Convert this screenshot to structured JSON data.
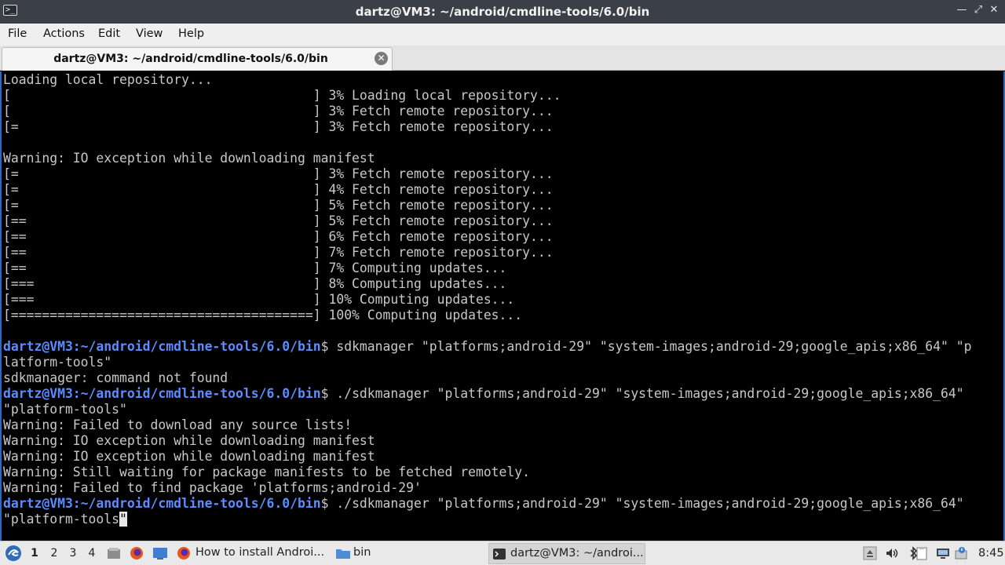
{
  "window": {
    "title": "dartz@VM3: ~/android/cmdline-tools/6.0/bin",
    "controls": [
      "—",
      "⤢",
      "✕"
    ]
  },
  "menu": [
    "File",
    "Actions",
    "Edit",
    "View",
    "Help"
  ],
  "tab": {
    "label": "dartz@VM3: ~/android/cmdline-tools/6.0/bin",
    "close": "✕"
  },
  "terminal": {
    "prompt": "dartz@VM3:~/android/cmdline-tools/6.0/bin",
    "lines": [
      {
        "text": "Loading local repository..."
      },
      {
        "text": "[                                       ] 3% Loading local repository..."
      },
      {
        "text": "[                                       ] 3% Fetch remote repository..."
      },
      {
        "text": "[=                                      ] 3% Fetch remote repository..."
      },
      {
        "text": ""
      },
      {
        "text": "Warning: IO exception while downloading manifest"
      },
      {
        "text": "[=                                      ] 3% Fetch remote repository..."
      },
      {
        "text": "[=                                      ] 4% Fetch remote repository..."
      },
      {
        "text": "[=                                      ] 5% Fetch remote repository..."
      },
      {
        "text": "[==                                     ] 5% Fetch remote repository..."
      },
      {
        "text": "[==                                     ] 6% Fetch remote repository..."
      },
      {
        "text": "[==                                     ] 7% Fetch remote repository..."
      },
      {
        "text": "[==                                     ] 7% Computing updates..."
      },
      {
        "text": "[===                                    ] 8% Computing updates..."
      },
      {
        "text": "[===                                    ] 10% Computing updates..."
      },
      {
        "text": "[=======================================] 100% Computing updates..."
      },
      {
        "text": ""
      },
      {
        "prompt": true,
        "text": "$ sdkmanager \"platforms;android-29\" \"system-images;android-29;google_apis;x86_64\" \"p"
      },
      {
        "text": "latform-tools\""
      },
      {
        "text": "sdkmanager: command not found"
      },
      {
        "prompt": true,
        "text": "$ ./sdkmanager \"platforms;android-29\" \"system-images;android-29;google_apis;x86_64\""
      },
      {
        "text": "\"platform-tools\""
      },
      {
        "text": "Warning: Failed to download any source lists!"
      },
      {
        "text": "Warning: IO exception while downloading manifest"
      },
      {
        "text": "Warning: IO exception while downloading manifest"
      },
      {
        "text": "Warning: Still waiting for package manifests to be fetched remotely."
      },
      {
        "text": "Warning: Failed to find package 'platforms;android-29'"
      },
      {
        "prompt": true,
        "text": "$ ./sdkmanager \"platforms;android-29\" \"system-images;android-29;google_apis;x86_64\""
      },
      {
        "text": "\"platform-tools",
        "cursor": "\""
      }
    ]
  },
  "taskbar": {
    "workspaces": [
      "1",
      "2",
      "3",
      "4"
    ],
    "active_workspace": "1",
    "tasks": [
      {
        "label": "How to install Androi...",
        "icon": "firefox-icon"
      },
      {
        "label": "bin",
        "icon": "folder-icon"
      },
      {
        "label": "dartz@VM3: ~/androi...",
        "icon": "terminal-icon",
        "active": true
      }
    ],
    "clock": "8:45"
  },
  "colors": {
    "prompt": "#5c8cff",
    "terminal_bg": "#000000",
    "terminal_fg": "#c8c8c8",
    "titlebar_bg": "#3b4048"
  }
}
